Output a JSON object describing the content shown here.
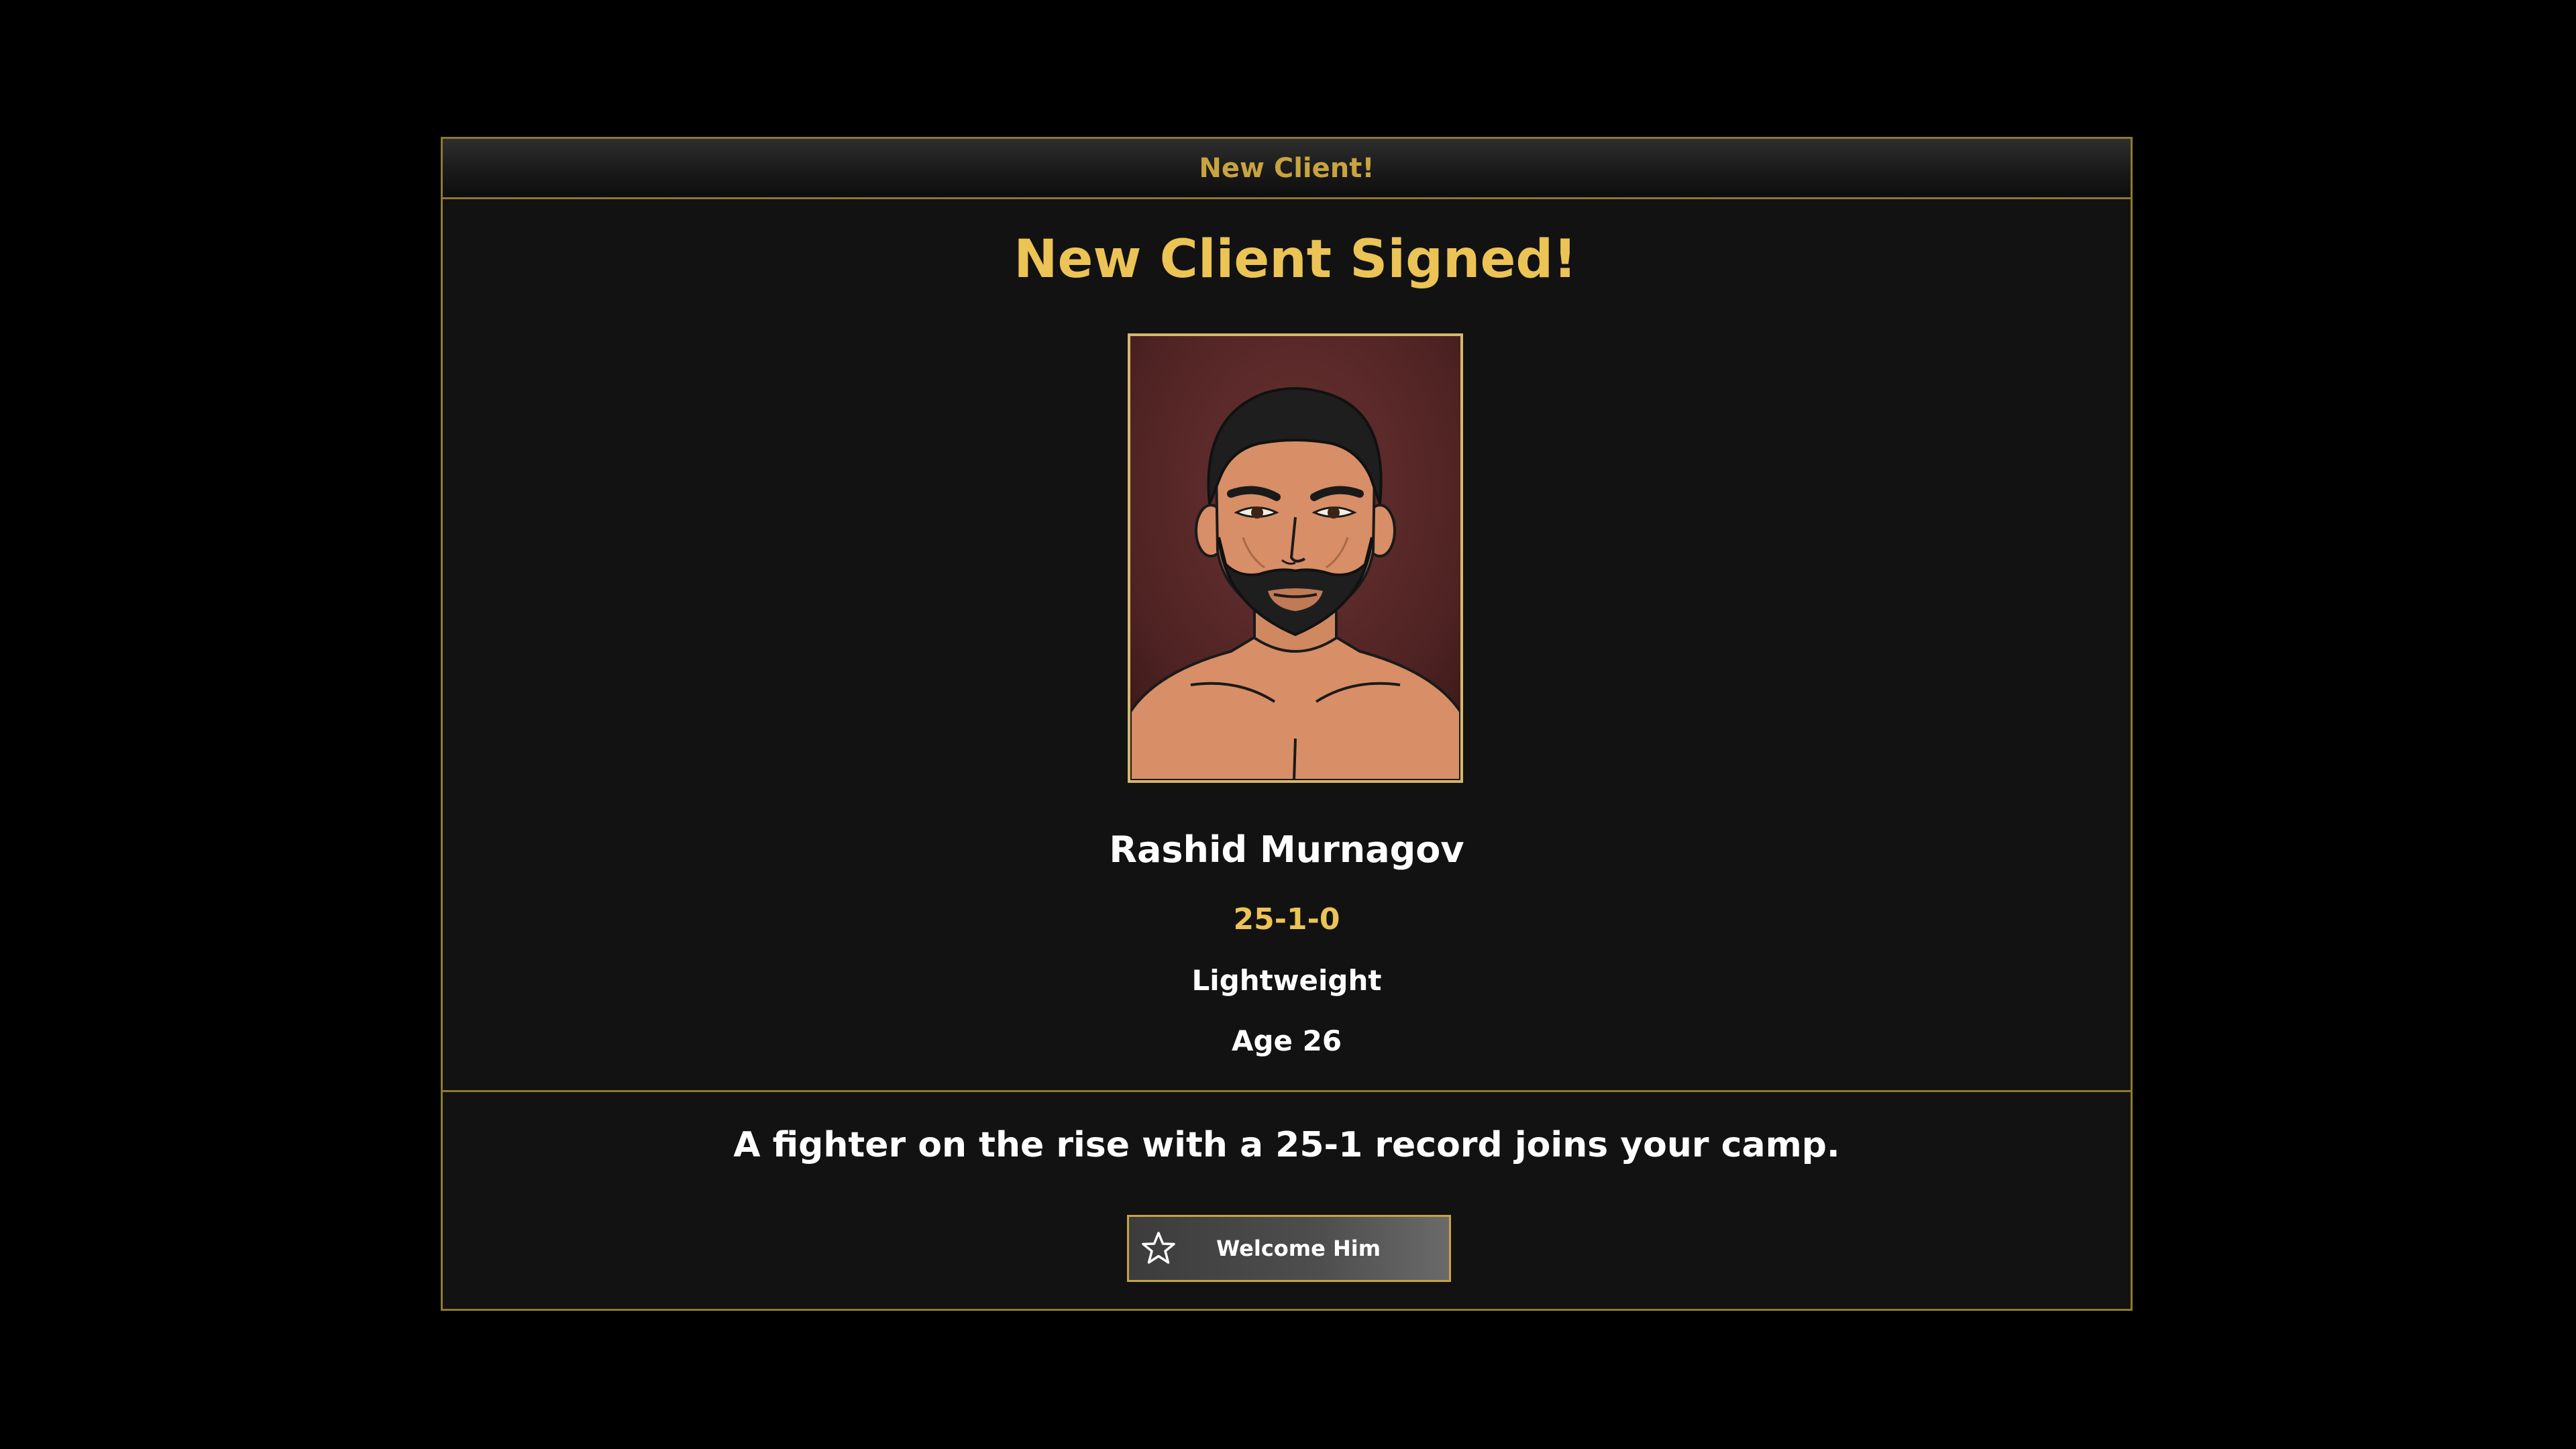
{
  "dialog": {
    "header_title": "New Client!",
    "title": "New Client Signed!",
    "fighter": {
      "portrait_icon": "fighter-portrait",
      "name": "Rashid Murnagov",
      "record": "25-1-0",
      "weight_class": "Lightweight",
      "age": "Age 26"
    },
    "message": "A fighter on the rise with a 25-1 record joins your camp.",
    "button": {
      "label": "Welcome Him",
      "icon": "star-icon"
    }
  },
  "colors": {
    "background": "#000000",
    "panel": "#121212",
    "border_gold": "#8f7a2c",
    "title_gold": "#ecc355",
    "header_gold": "#c8a340",
    "text_white": "#ffffff"
  }
}
